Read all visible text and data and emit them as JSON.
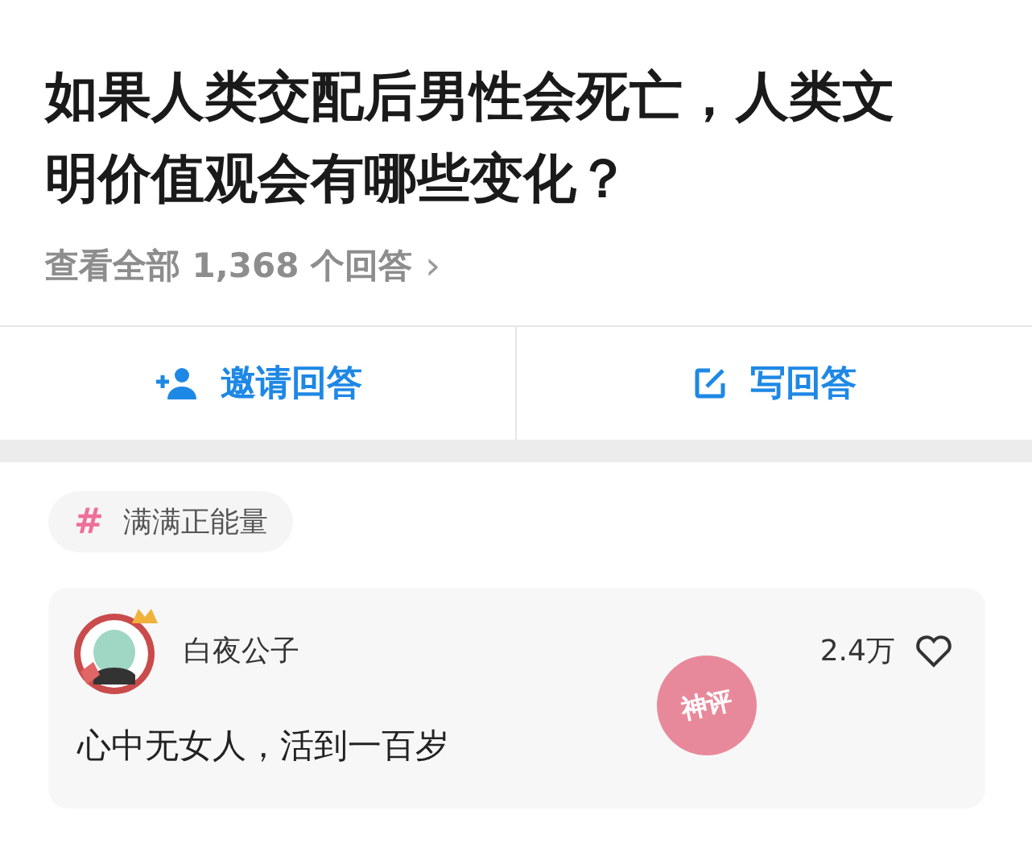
{
  "question": {
    "title": "如果人类交配后男性会死亡，人类文明价值观会有哪些变化？",
    "all_answers": "查看全部 1,368 个回答",
    "chevron": "›"
  },
  "actions": [
    {
      "kind": "invite",
      "label": "邀请回答"
    },
    {
      "kind": "write",
      "label": "写回答"
    }
  ],
  "tag": {
    "symbol": "#",
    "label": "满满正能量"
  },
  "comment": {
    "author": "白夜公子",
    "text": "心中无女人，活到一百岁",
    "likes": "2.4万",
    "stamp": "神评"
  }
}
